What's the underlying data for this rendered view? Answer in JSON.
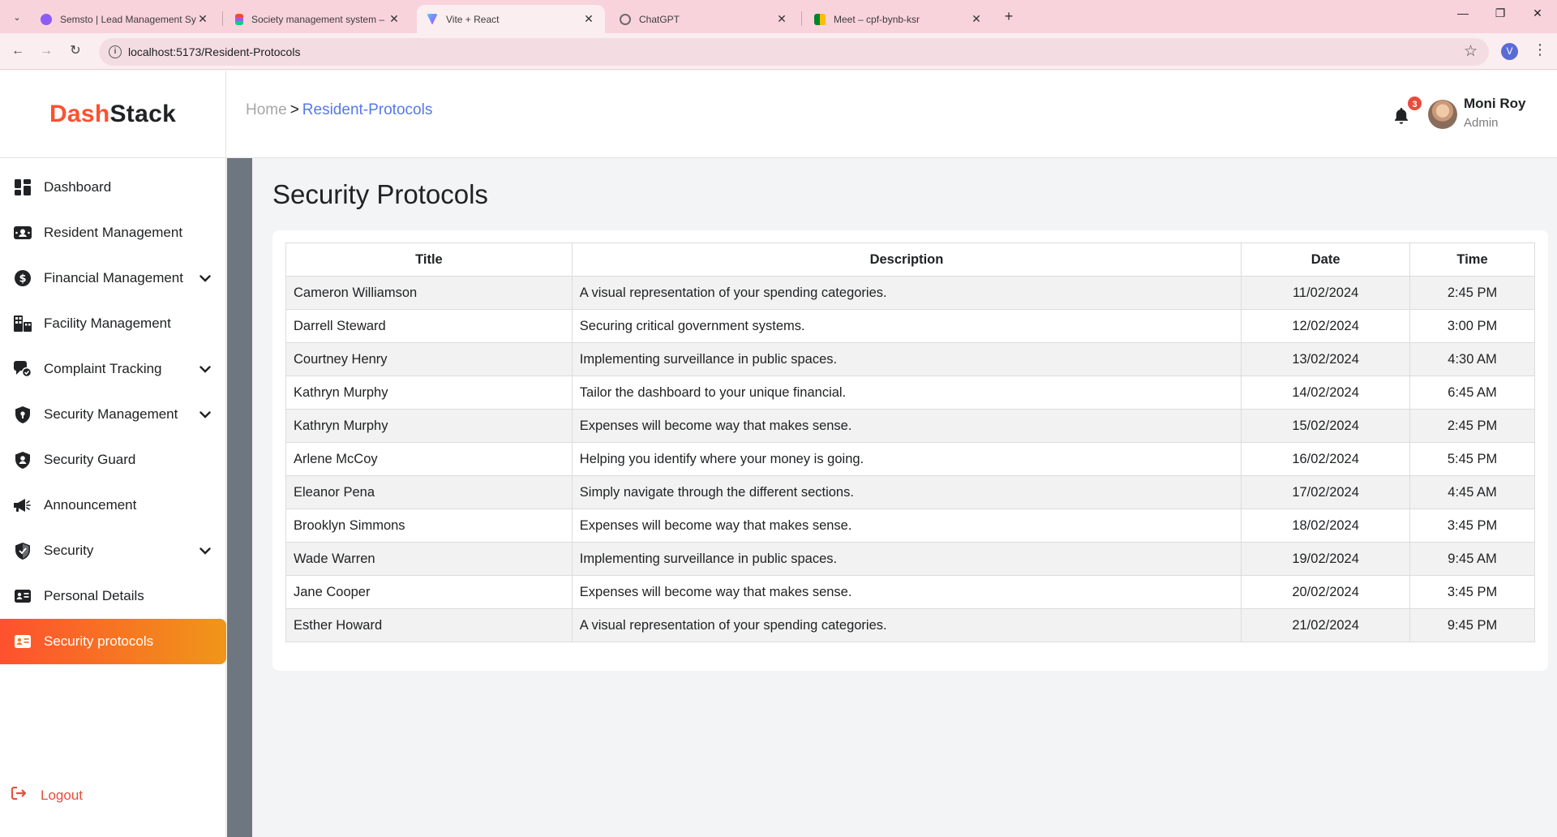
{
  "browser": {
    "tabs": [
      {
        "title": "Semsto | Lead Management Sy",
        "favicon_color": "#8b5cf6"
      },
      {
        "title": "Society management system – F",
        "favicon_color": "#f24e1e"
      },
      {
        "title": "Vite + React",
        "favicon_color": "#a855f7"
      },
      {
        "title": "ChatGPT",
        "favicon_color": "#6b6b6b"
      },
      {
        "title": "Meet – cpf-bynb-ksr",
        "favicon_color": "#00832d"
      }
    ],
    "active_tab_index": 2,
    "url": "localhost:5173/Resident-Protocols",
    "profile_initial": "V"
  },
  "brand": {
    "part1": "Dash",
    "part2": "Stack",
    "accent": "#fe512e"
  },
  "breadcrumb": {
    "home": "Home",
    "separator": ">",
    "current": "Resident-Protocols"
  },
  "notifications": {
    "count": "3"
  },
  "user": {
    "name": "Moni Roy",
    "role": "Admin"
  },
  "sidebar": {
    "items": [
      {
        "label": "Dashboard",
        "icon": "dashboard-icon",
        "has_chevron": false
      },
      {
        "label": "Resident Management",
        "icon": "resident-icon",
        "has_chevron": false
      },
      {
        "label": "Financial Management",
        "icon": "dollar-icon",
        "has_chevron": true
      },
      {
        "label": "Facility Management",
        "icon": "building-icon",
        "has_chevron": false
      },
      {
        "label": "Complaint Tracking",
        "icon": "complaint-icon",
        "has_chevron": true
      },
      {
        "label": "Security Management",
        "icon": "shield-icon",
        "has_chevron": true
      },
      {
        "label": "Security Guard",
        "icon": "guard-icon",
        "has_chevron": false
      },
      {
        "label": "Announcement",
        "icon": "megaphone-icon",
        "has_chevron": false
      },
      {
        "label": "Security",
        "icon": "shield-check-icon",
        "has_chevron": true
      },
      {
        "label": "Personal Details",
        "icon": "id-card-icon",
        "has_chevron": false
      },
      {
        "label": "Security protocols",
        "icon": "id-card-icon",
        "has_chevron": false,
        "active": true
      }
    ],
    "logout": "Logout"
  },
  "main": {
    "title": "Security Protocols",
    "table": {
      "headers": [
        "Title",
        "Description",
        "Date",
        "Time"
      ],
      "rows": [
        {
          "title": "Cameron Williamson",
          "description": "A visual representation of your spending categories.",
          "date": "11/02/2024",
          "time": "2:45 PM"
        },
        {
          "title": "Darrell Steward",
          "description": "Securing critical government systems.",
          "date": "12/02/2024",
          "time": "3:00 PM"
        },
        {
          "title": "Courtney Henry",
          "description": "Implementing surveillance in public spaces.",
          "date": "13/02/2024",
          "time": "4:30 AM"
        },
        {
          "title": "Kathryn Murphy",
          "description": "Tailor the dashboard to your unique financial.",
          "date": "14/02/2024",
          "time": "6:45 AM"
        },
        {
          "title": "Kathryn Murphy",
          "description": "Expenses will become way that makes sense.",
          "date": "15/02/2024",
          "time": "2:45 PM"
        },
        {
          "title": "Arlene McCoy",
          "description": "Helping you identify where your money is going.",
          "date": "16/02/2024",
          "time": "5:45 PM"
        },
        {
          "title": "Eleanor Pena",
          "description": "Simply navigate through the different sections.",
          "date": "17/02/2024",
          "time": "4:45 AM"
        },
        {
          "title": "Brooklyn Simmons",
          "description": "Expenses will become way that makes sense.",
          "date": "18/02/2024",
          "time": "3:45 PM"
        },
        {
          "title": "Wade Warren",
          "description": "Implementing surveillance in public spaces.",
          "date": "19/02/2024",
          "time": "9:45 AM"
        },
        {
          "title": "Jane Cooper",
          "description": "Expenses will become way that makes sense.",
          "date": "20/02/2024",
          "time": "3:45 PM"
        },
        {
          "title": "Esther Howard",
          "description": "A visual representation of your spending categories.",
          "date": "21/02/2024",
          "time": "9:45 PM"
        }
      ]
    }
  }
}
